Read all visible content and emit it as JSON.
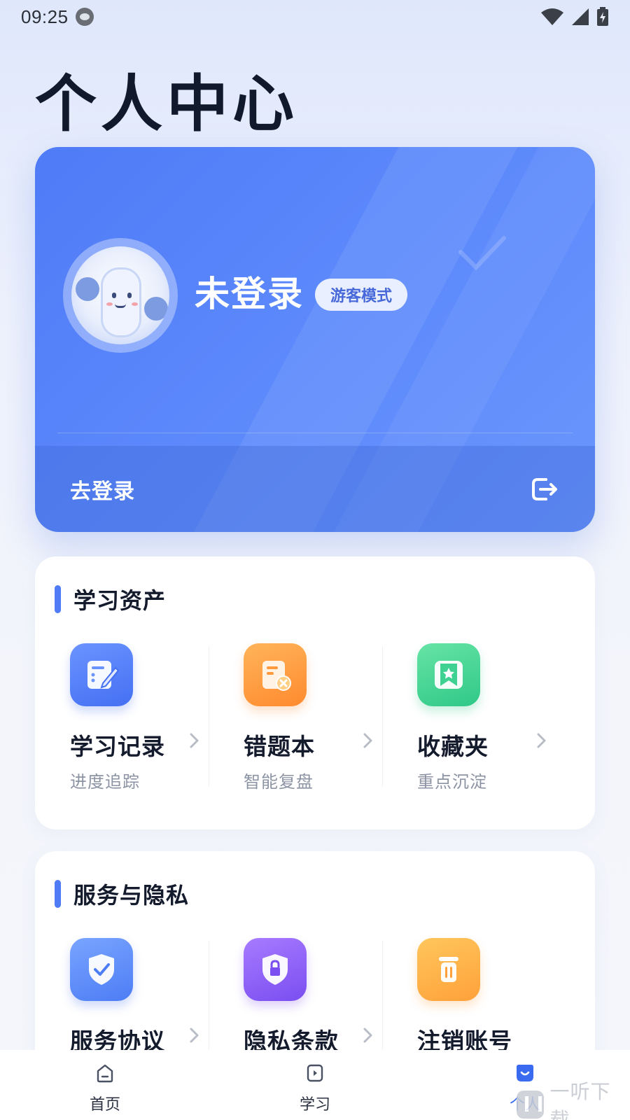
{
  "status_bar": {
    "time": "09:25"
  },
  "page_title": "个人中心",
  "profile": {
    "name": "未登录",
    "badge": "游客模式",
    "login_label": "去登录"
  },
  "learning_assets": {
    "title": "学习资产",
    "items": [
      {
        "label": "学习记录",
        "sub": "进度追踪",
        "icon": "study-record-icon",
        "color": "#4f7bf7"
      },
      {
        "label": "错题本",
        "sub": "智能复盘",
        "icon": "wrong-question-book-icon",
        "color": "#ff952f"
      },
      {
        "label": "收藏夹",
        "sub": "重点沉淀",
        "icon": "favorites-bookmark-icon",
        "color": "#3fd192"
      }
    ]
  },
  "service_privacy": {
    "title": "服务与隐私",
    "items": [
      {
        "label": "服务协议",
        "icon": "shield-check-icon",
        "color": "#5a86f7"
      },
      {
        "label": "隐私条款",
        "icon": "privacy-lock-icon",
        "color": "#8a5cf5"
      },
      {
        "label": "注销账号",
        "icon": "trash-icon",
        "color": "#ffad44"
      }
    ]
  },
  "bottom_nav": {
    "items": [
      {
        "label": "首页",
        "icon": "home-icon"
      },
      {
        "label": "学习",
        "icon": "study-play-icon"
      },
      {
        "label": "个人",
        "icon": "profile-icon",
        "active": true
      }
    ]
  },
  "watermark": {
    "text": "一听下载"
  }
}
